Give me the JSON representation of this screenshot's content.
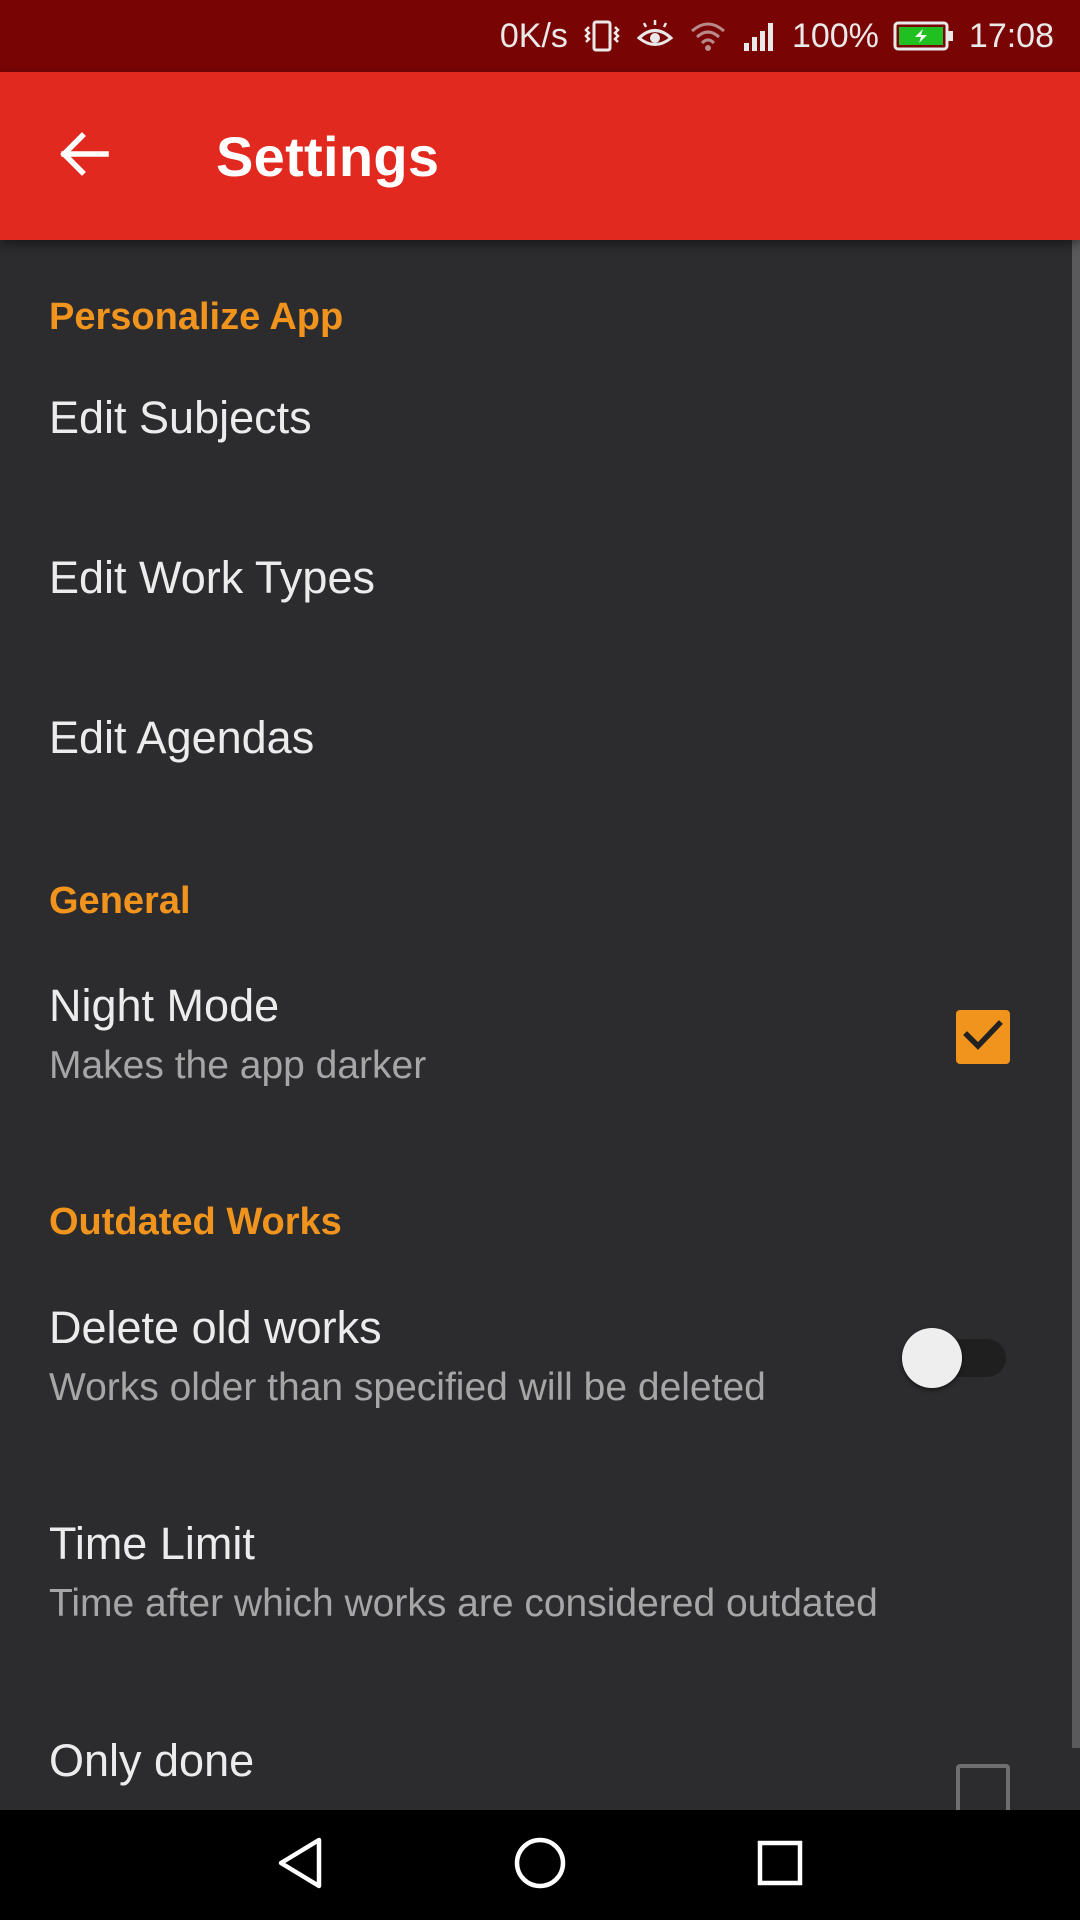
{
  "status_bar": {
    "net_speed": "0K/s",
    "battery_percent": "100%",
    "time": "17:08",
    "icons": [
      "vibrate-icon",
      "eye-comfort-icon",
      "wifi-icon",
      "cell-signal-icon",
      "battery-charging-icon"
    ]
  },
  "app_bar": {
    "title": "Settings",
    "back_icon": "arrow-back-icon",
    "color": "#e2291f"
  },
  "theme": {
    "accent": "#f0941e",
    "background": "#2c2c2e",
    "status_bar_color": "#790404"
  },
  "sections": {
    "personalize": {
      "header": "Personalize App",
      "edit_subjects": "Edit Subjects",
      "edit_work_types": "Edit Work Types",
      "edit_agendas": "Edit Agendas"
    },
    "general": {
      "header": "General",
      "night_mode": {
        "title": "Night Mode",
        "summary": "Makes the app darker",
        "checked": true
      }
    },
    "outdated": {
      "header": "Outdated Works",
      "delete_old": {
        "title": "Delete old works",
        "summary": "Works older than specified will be deleted",
        "enabled": false
      },
      "time_limit": {
        "title": "Time Limit",
        "summary": "Time after which works are considered outdated"
      },
      "only_done": {
        "title": "Only done",
        "checked": false
      }
    }
  },
  "nav_bar": {
    "icons": [
      "nav-back-icon",
      "nav-home-icon",
      "nav-recents-icon"
    ]
  }
}
